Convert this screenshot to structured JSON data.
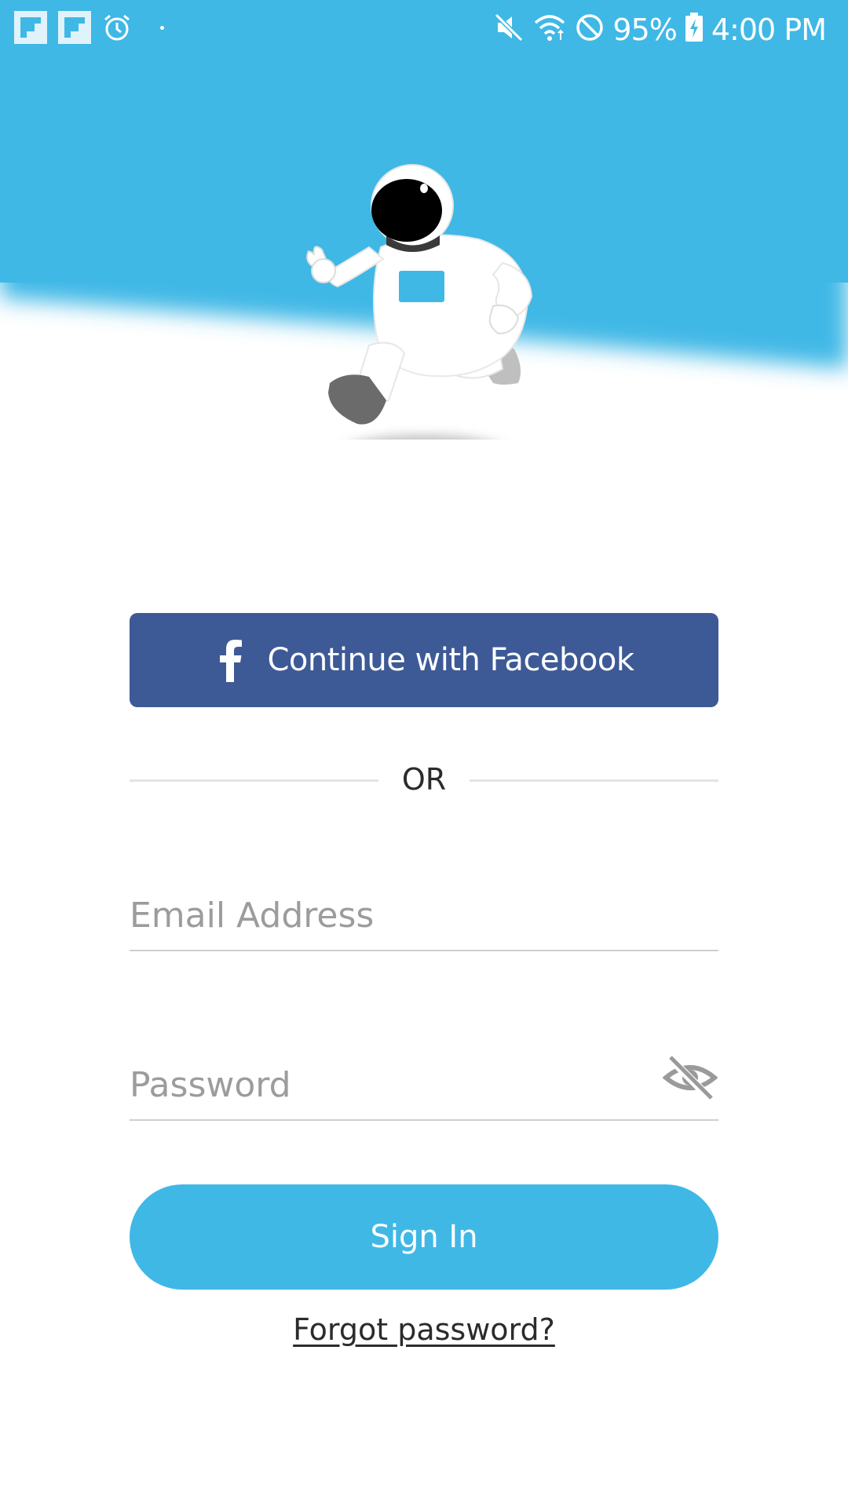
{
  "status_bar": {
    "battery_percent": "95%",
    "time": "4:00 PM",
    "left_icons": [
      "flipboard-icon",
      "flipboard-icon",
      "alarm-icon",
      "notification-dot"
    ],
    "right_icons": [
      "mute-icon",
      "wifi-icon",
      "do-not-disturb-icon",
      "battery-charging-icon"
    ]
  },
  "hero": {
    "illustration": "astronaut-running-illustration",
    "sky_color": "#3fb8e6"
  },
  "login": {
    "facebook_label": "Continue with Facebook",
    "facebook_color": "#3d5a96",
    "divider_text": "OR",
    "email_placeholder": "Email Address",
    "email_value": "",
    "password_placeholder": "Password",
    "password_value": "",
    "password_visibility_icon": "eye-off-icon",
    "signin_label": "Sign In",
    "signin_color": "#3fb8e6",
    "forgot_label": "Forgot password?"
  }
}
